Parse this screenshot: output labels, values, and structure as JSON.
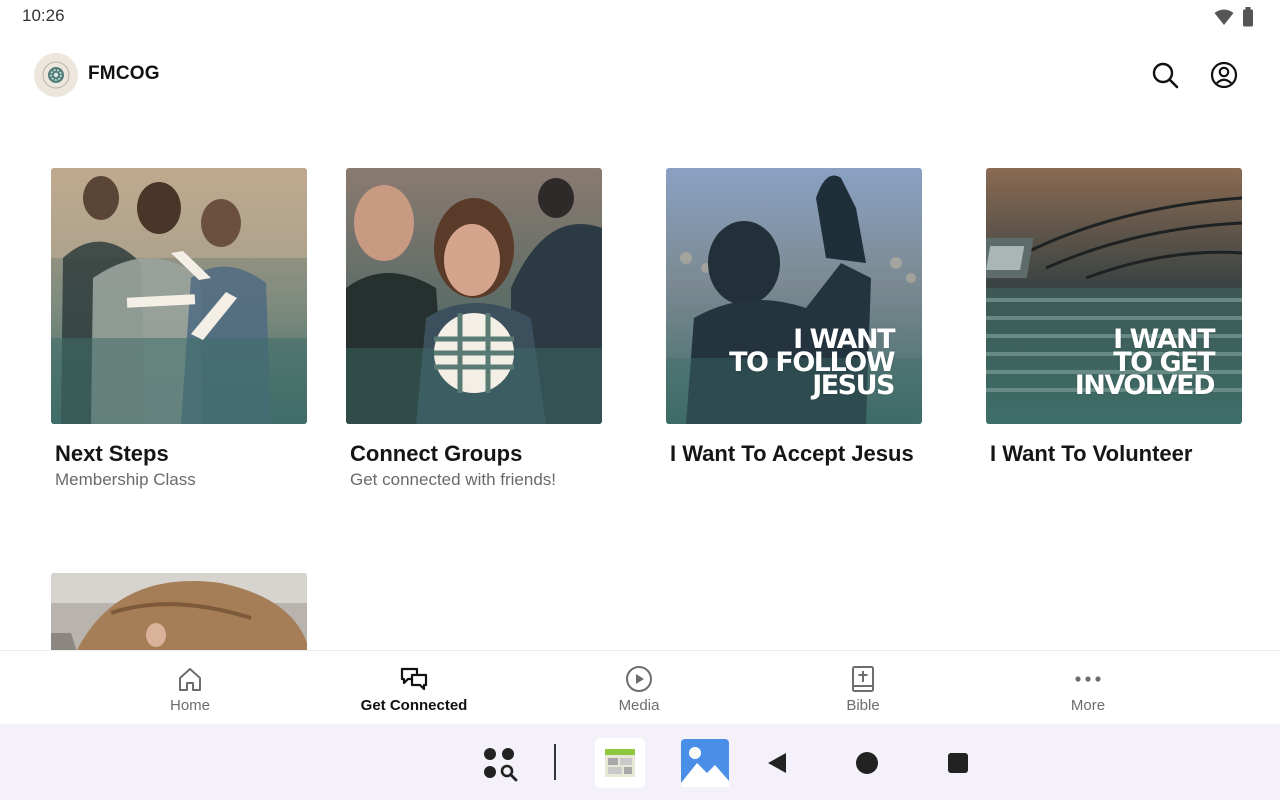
{
  "status": {
    "time": "10:26",
    "wifi_icon": "wifi-icon",
    "battery_icon": "battery-icon"
  },
  "app_bar": {
    "title": "FMCOG",
    "logo_icon": "church-logo-icon",
    "search_icon": "search-icon",
    "account_icon": "account-icon"
  },
  "cards": [
    {
      "title": "Next Steps",
      "subtitle": "Membership Class",
      "image": "people-talking-photo"
    },
    {
      "title": "Connect Groups",
      "subtitle": "Get connected with friends!",
      "image": "couple-smiling-photo"
    },
    {
      "title": "I Want To Accept Jesus",
      "subtitle": "",
      "image": "raised-hand-photo",
      "overlay_text": [
        "I WANT",
        "TO FOLLOW",
        "JESUS"
      ]
    },
    {
      "title": "I Want To Volunteer",
      "subtitle": "",
      "image": "sound-board-photo",
      "overlay_text": [
        "I WANT",
        "TO GET",
        "INVOLVED"
      ]
    },
    {
      "title": "",
      "subtitle": "",
      "image": "woman-hair-photo"
    }
  ],
  "bottom_nav": [
    {
      "label": "Home",
      "icon": "home-icon",
      "active": false
    },
    {
      "label": "Get Connected",
      "icon": "chat-bubbles-icon",
      "active": true
    },
    {
      "label": "Media",
      "icon": "play-circle-icon",
      "active": false
    },
    {
      "label": "Bible",
      "icon": "bible-icon",
      "active": false
    },
    {
      "label": "More",
      "icon": "more-dots-icon",
      "active": false
    }
  ],
  "system_nav": {
    "apps_search_icon": "apps-search-icon",
    "recent_app_1": "calendar-app-icon",
    "recent_app_2": "gallery-app-icon",
    "back_icon": "back-icon",
    "home_icon": "home-circle-icon",
    "overview_icon": "overview-square-icon"
  },
  "colors": {
    "accent": "#111111",
    "muted": "#6a6a6a",
    "teal_overlay": "#3f6e69",
    "system_nav_bg": "#f4f1fa"
  }
}
